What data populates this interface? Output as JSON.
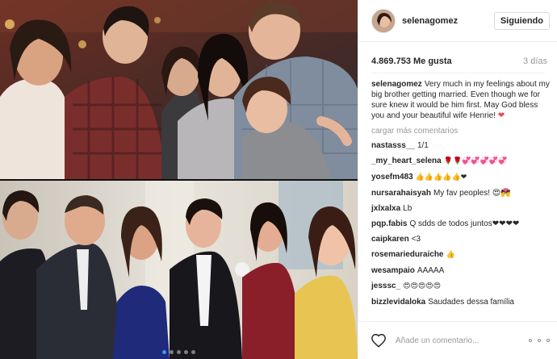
{
  "post": {
    "username": "selenagomez",
    "follow_label": "Siguiendo",
    "likes": "4.869.753 Me gusta",
    "time": "3 días"
  },
  "caption": {
    "author": "selenagomez",
    "text": "Very much in my feelings about my big brother getting married. Even though we for sure knew it would be him first. May God bless you and your beautiful wife Henrie!",
    "emoji": "❤"
  },
  "load_more": "cargar más comentarios",
  "comments": [
    {
      "author": "nastasss__",
      "text": "1/1"
    },
    {
      "author": "_my_heart_selena",
      "text": "🌹🌹💞💞💞💞💞"
    },
    {
      "author": "yosefm483",
      "text": "👍👍👍👍👍❤"
    },
    {
      "author": "nursarahaisyah",
      "text": "My fav peoples! 😍💏"
    },
    {
      "author": "jxlxalxa",
      "text": "Lb"
    },
    {
      "author": "pqp.fabis",
      "text": "Q sdds de todos juntos❤❤❤❤"
    },
    {
      "author": "caipkaren",
      "text": "<3"
    },
    {
      "author": "rosemarieduraiche",
      "text": "👍"
    },
    {
      "author": "wesampaio",
      "text": "AAAAA"
    },
    {
      "author": "jesssc_",
      "text": "😍😍😍😍😍"
    },
    {
      "author": "bizzlevidaloka",
      "text": "Saudades dessa família"
    }
  ],
  "footer": {
    "comment_placeholder": "Añade un comentario..."
  },
  "icons": {
    "like": "heart-outline-icon",
    "more": "more-options-icon"
  },
  "carousel": {
    "count": 5,
    "active": 0
  },
  "colors": {
    "link": "#3897f0",
    "heart": "#ed4956",
    "muted": "#999999"
  }
}
